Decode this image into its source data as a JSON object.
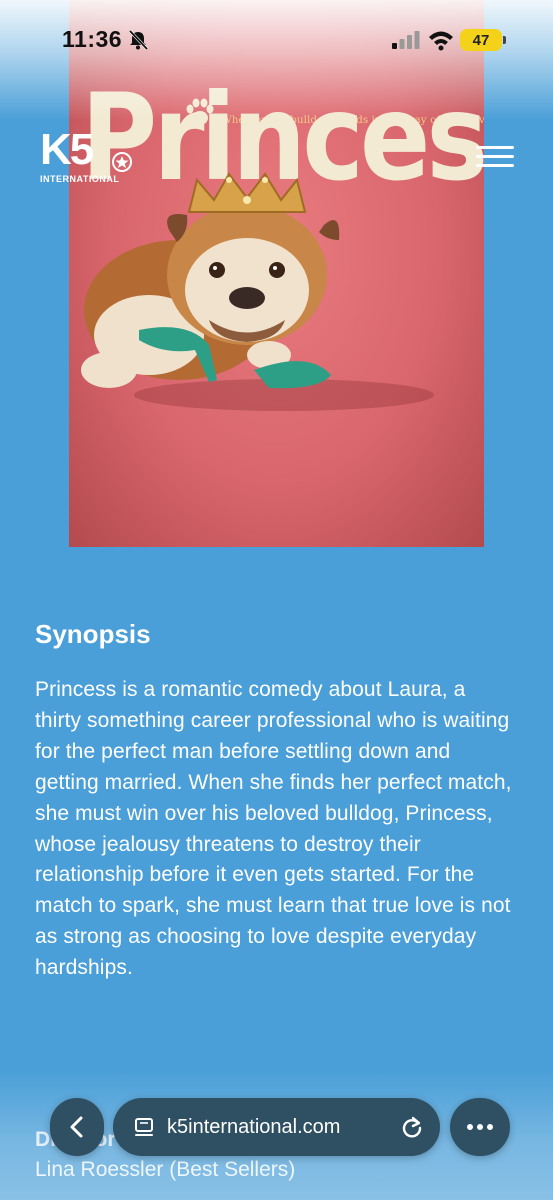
{
  "status_bar": {
    "time": "11:36",
    "battery": "47"
  },
  "poster": {
    "title": "Princess",
    "tagline": "When only a bulldog stands in the way of true love"
  },
  "logo": {
    "mark": "K5",
    "subtitle": "INTERNATIONAL"
  },
  "synopsis": {
    "heading": "Synopsis",
    "body": "Princess is a romantic comedy about Laura, a thirty something career professional who is waiting for the perfect man before settling down and getting married. When she finds her perfect match, she must win over his beloved bulldog, Princess, whose jealousy threatens to destroy their relationship before it even gets started. For the match to spark, she must learn that true love is not as strong as choosing to love despite everyday hardships."
  },
  "director": {
    "label": "Director",
    "name": "Lina Roessler (Best Sellers)"
  },
  "browser": {
    "url": "k5international.com"
  },
  "icons": {
    "silent": "bell-slash-icon",
    "signal": "cellular-signal-icon",
    "wifi": "wifi-icon",
    "back": "chevron-left-icon",
    "site": "site-info-icon",
    "reload": "reload-icon",
    "more": "more-dots-icon",
    "menu": "hamburger-menu-icon"
  },
  "colors": {
    "page_background": "#4a9fd8",
    "poster_background": "#d9666d",
    "browser_pill": "#2f4f63",
    "battery": "#f4d219"
  }
}
